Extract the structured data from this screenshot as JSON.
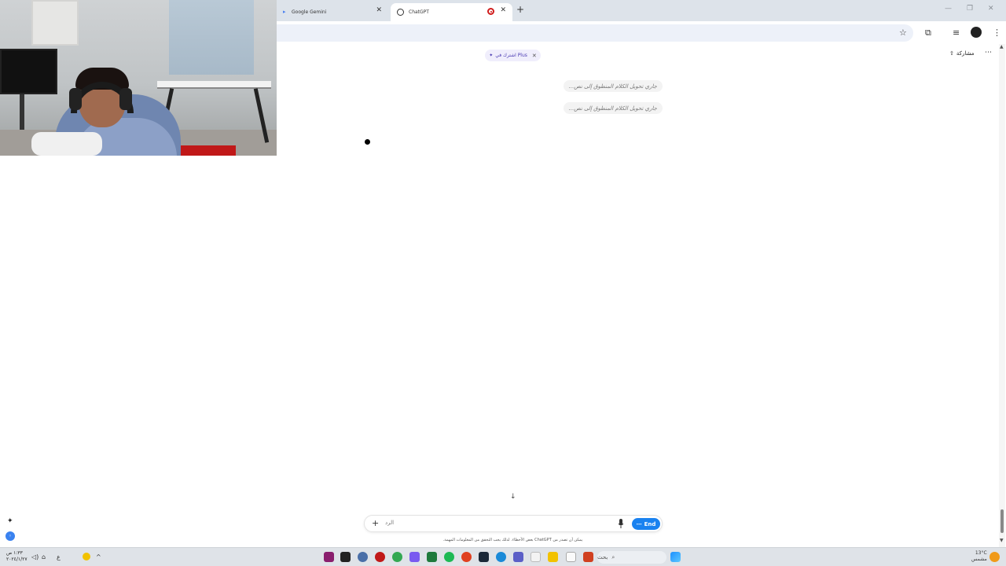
{
  "browser": {
    "tabs": [
      {
        "label": "Google Gemini",
        "active": false
      },
      {
        "label": "ChatGPT",
        "active": true
      }
    ],
    "new_tab_label": "+"
  },
  "header": {
    "plus_pill_label": "اشترك في Plus",
    "share_label": "مشاركة"
  },
  "messages": [
    {
      "text": "جاري تحويل الكلام المنطوق إلى نص..."
    },
    {
      "text": "جاري تحويل الكلام المنطوق إلى نص..."
    }
  ],
  "composer": {
    "placeholder": "الرد",
    "end_label": "End"
  },
  "disclaimer": "يمكن أن تصدر من ChatGPT بعض الأخطاء. لذلك يجب التحقق من المعلومات المهمة.",
  "taskbar": {
    "clock_time": "١:٣٣ ص",
    "clock_date": "٢٠٢٤/١/٢٧",
    "search_label": "بحث",
    "weather_temp": "13°C",
    "weather_desc": "مشمس",
    "tray_lang": "ع"
  },
  "colors": {
    "accent": "#1a82f0",
    "plus_pill_text": "#4b3bb3",
    "recording": "#d01c1c"
  },
  "icons": [
    "gemini-icon",
    "chatgpt-icon",
    "record-icon",
    "close-icon",
    "bookmark-star-icon",
    "extensions-icon",
    "tab-search-icon",
    "profile-avatar",
    "menu-icon",
    "share-icon",
    "more-icon",
    "plus-icon",
    "mic-icon",
    "voice-waves-icon",
    "scroll-down-icon",
    "sparkle-icon",
    "search-icon",
    "windows-start-icon",
    "weather-sun-icon"
  ]
}
